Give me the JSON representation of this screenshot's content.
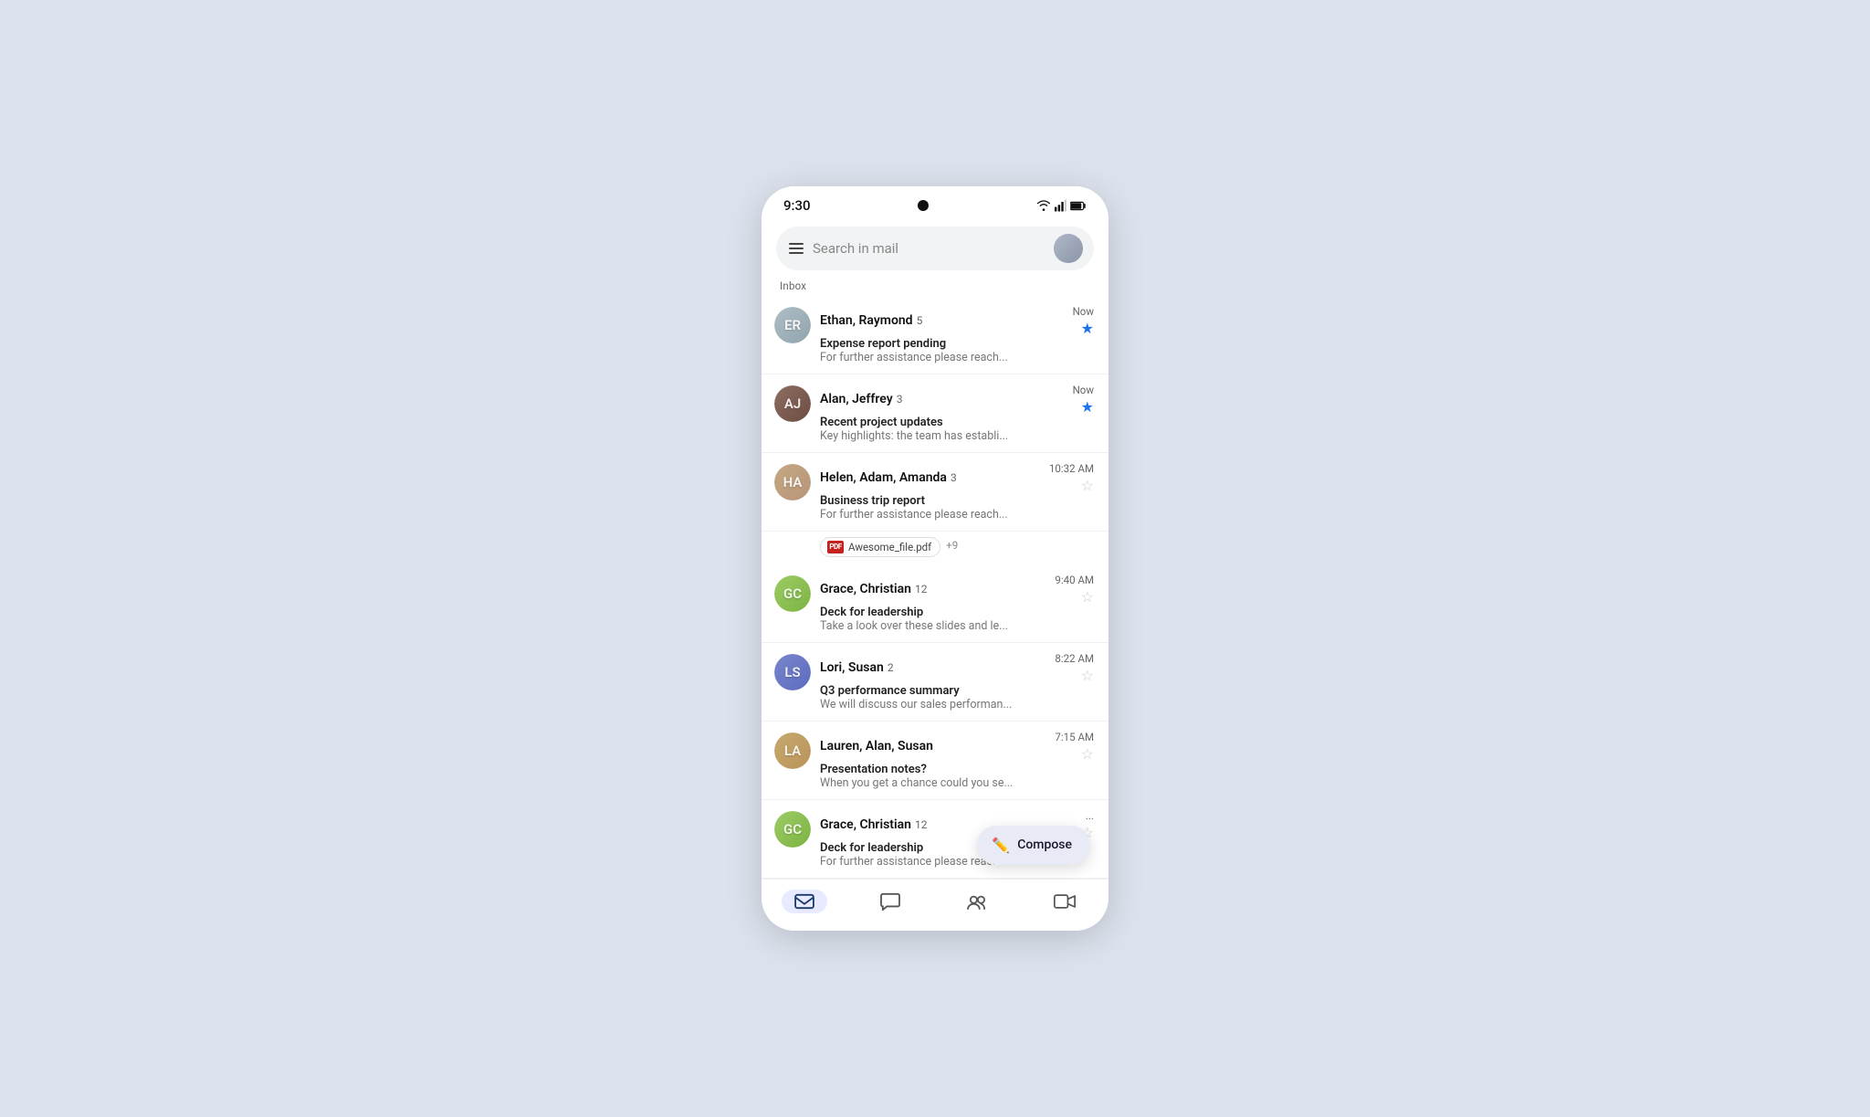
{
  "status_bar": {
    "time": "9:30",
    "icons": [
      "wifi",
      "signal",
      "battery"
    ]
  },
  "search_bar": {
    "placeholder": "Search in mail"
  },
  "section": {
    "label": "Inbox"
  },
  "emails": [
    {
      "id": 1,
      "sender": "Ethan, Raymond",
      "count": 5,
      "time": "Now",
      "subject": "Expense report pending",
      "preview": "For further assistance please reach...",
      "starred": true,
      "avatar_initials": "ER",
      "avatar_class": "av-ethan",
      "has_attachment": false
    },
    {
      "id": 2,
      "sender": "Alan, Jeffrey",
      "count": 3,
      "time": "Now",
      "subject": "Recent project updates",
      "preview": "Key highlights: the team has establi...",
      "starred": true,
      "avatar_initials": "AJ",
      "avatar_class": "av-alan",
      "has_attachment": false
    },
    {
      "id": 3,
      "sender": "Helen, Adam, Amanda",
      "count": 3,
      "time": "10:32 AM",
      "subject": "Business trip report",
      "preview": "For further assistance please reach...",
      "starred": false,
      "avatar_initials": "HA",
      "avatar_class": "av-helen",
      "has_attachment": true,
      "attachment_name": "Awesome_file.pdf",
      "attachment_extra": "+9"
    },
    {
      "id": 4,
      "sender": "Grace, Christian",
      "count": 12,
      "time": "9:40 AM",
      "subject": "Deck for leadership",
      "preview": "Take a look over these slides and le...",
      "starred": false,
      "avatar_initials": "GC",
      "avatar_class": "av-grace",
      "has_attachment": false
    },
    {
      "id": 5,
      "sender": "Lori, Susan",
      "count": 2,
      "time": "8:22 AM",
      "subject": "Q3 performance summary",
      "preview": "We will discuss our sales performan...",
      "starred": false,
      "avatar_initials": "LS",
      "avatar_class": "av-lori",
      "has_attachment": false
    },
    {
      "id": 6,
      "sender": "Lauren, Alan, Susan",
      "count": null,
      "time": "7:15 AM",
      "subject": "Presentation notes?",
      "preview": "When you get a chance could you se...",
      "starred": false,
      "avatar_initials": "LA",
      "avatar_class": "av-lauren",
      "has_attachment": false
    },
    {
      "id": 7,
      "sender": "Grace, Christian",
      "count": 12,
      "time": "...",
      "subject": "Deck for leadership",
      "preview": "For further assistance please reac...",
      "starred": false,
      "avatar_initials": "GC",
      "avatar_class": "av-grace2",
      "has_attachment": false
    }
  ],
  "compose": {
    "label": "Compose",
    "icon": "✏️"
  },
  "bottom_nav": [
    {
      "id": "mail",
      "label": "Mail",
      "icon": "✉",
      "active": true
    },
    {
      "id": "chat",
      "label": "Chat",
      "icon": "💬",
      "active": false
    },
    {
      "id": "spaces",
      "label": "Spaces",
      "icon": "👥",
      "active": false
    },
    {
      "id": "meet",
      "label": "Meet",
      "icon": "🎥",
      "active": false
    }
  ]
}
